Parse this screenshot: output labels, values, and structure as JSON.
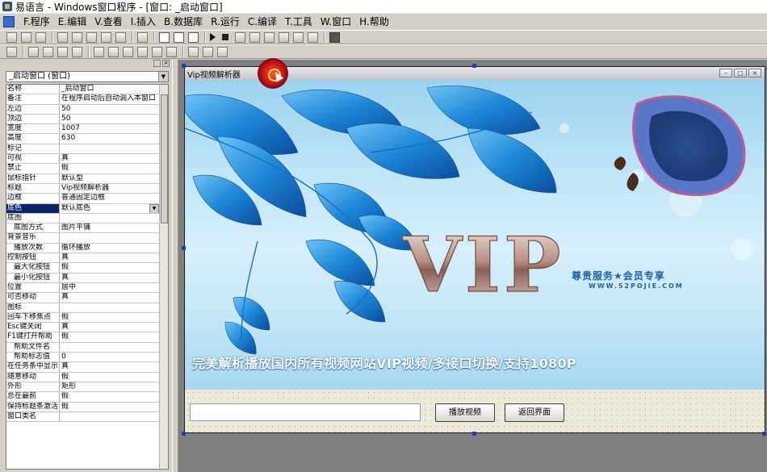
{
  "titlebar": {
    "text": "易语言 - Windows窗口程序 - [窗口: _启动窗口]"
  },
  "menu": [
    {
      "label": "F.程序"
    },
    {
      "label": "E.编辑"
    },
    {
      "label": "V.查看"
    },
    {
      "label": "I.插入"
    },
    {
      "label": "B.数据库"
    },
    {
      "label": "R.运行"
    },
    {
      "label": "C.编译"
    },
    {
      "label": "T.工具"
    },
    {
      "label": "W.窗口"
    },
    {
      "label": "H.帮助"
    }
  ],
  "object_selector": {
    "value": "_启动窗口 (窗口)"
  },
  "properties": [
    {
      "name": "名称",
      "value": "_启动窗口"
    },
    {
      "name": "备注",
      "value": "在程序启动后自动调入本窗口"
    },
    {
      "name": "左边",
      "value": "50"
    },
    {
      "name": "顶边",
      "value": "50"
    },
    {
      "name": "宽度",
      "value": "1007"
    },
    {
      "name": "高度",
      "value": "630"
    },
    {
      "name": "标记",
      "value": ""
    },
    {
      "name": "可视",
      "value": "真"
    },
    {
      "name": "禁止",
      "value": "假"
    },
    {
      "name": "鼠标指针",
      "value": "默认型"
    },
    {
      "name": "标题",
      "value": "Vip视频解析器"
    },
    {
      "name": "边框",
      "value": "普通固定边框"
    },
    {
      "name": "底色",
      "value": "默认底色",
      "selected": true
    },
    {
      "name": "底图",
      "value": ""
    },
    {
      "name": "底图方式",
      "value": "图片平铺",
      "indent": true
    },
    {
      "name": "背景音乐",
      "value": ""
    },
    {
      "name": "播放次数",
      "value": "循环播放",
      "indent": true
    },
    {
      "name": "控制按钮",
      "value": "真"
    },
    {
      "name": "最大化按钮",
      "value": "假",
      "indent": true
    },
    {
      "name": "最小化按钮",
      "value": "真",
      "indent": true
    },
    {
      "name": "位置",
      "value": "居中"
    },
    {
      "name": "可否移动",
      "value": "真"
    },
    {
      "name": "图标",
      "value": ""
    },
    {
      "name": "回车下移焦点",
      "value": "假"
    },
    {
      "name": "Esc键关闭",
      "value": "真"
    },
    {
      "name": "F1键打开帮助",
      "value": "假"
    },
    {
      "name": "帮助文件名",
      "value": "",
      "indent": true
    },
    {
      "name": "帮助标志值",
      "value": "0",
      "indent": true
    },
    {
      "name": "在任务条中显示",
      "value": "真"
    },
    {
      "name": "随意移动",
      "value": "假"
    },
    {
      "name": "外形",
      "value": "矩形"
    },
    {
      "name": "总在最前",
      "value": "假"
    },
    {
      "name": "保持标题条激活",
      "value": "假"
    },
    {
      "name": "窗口类名",
      "value": ""
    }
  ],
  "form": {
    "caption": "Vip视频解析器",
    "banner": {
      "logo_text": "VIP",
      "slogan": "尊贵服务★会员专享",
      "url": "WWW.52POJIE.COM",
      "headline": "完美解析播放国内所有视频网站VIP视频/多接口切换/支持1080P"
    },
    "input_value": "",
    "play_button": "播放视频",
    "return_button": "返回界面"
  },
  "colors": {
    "selection": "#0a246a",
    "banner_blue": "#1d5fa8",
    "leaf_blue": "#1f7fd0",
    "cursor_red": "#d01616"
  }
}
